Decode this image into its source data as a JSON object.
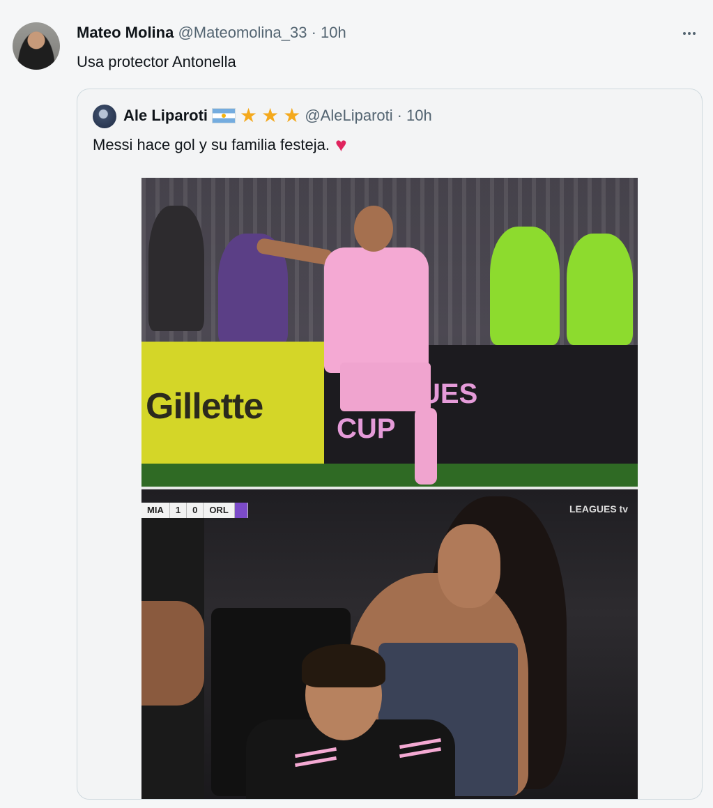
{
  "tweet": {
    "author_name": "Mateo Molina",
    "author_handle": "@Mateomolina_33",
    "separator": "·",
    "time": "10h",
    "text": "Usa protector Antonella"
  },
  "quote": {
    "author_name": "Ale Liparoti",
    "author_handle": "@AleLiparoti",
    "separator": "·",
    "time": "10h",
    "text": "Messi hace gol y su familia festeja.",
    "emoji_icons": [
      "argentina-flag-icon",
      "star-icon",
      "star-icon",
      "star-icon"
    ],
    "heart_icon": "red-heart-icon"
  },
  "media": {
    "ad_yellow": "Gillette",
    "ad_black_1": "AGUES",
    "ad_black_2": "CUP",
    "scorebug": {
      "home": "MIA",
      "home_score": "1",
      "away_score": "0",
      "away": "ORL"
    },
    "broadcast_logo": "LEAGUES  tv"
  },
  "colors": {
    "heart": "#e0245e",
    "star": "#f4a91d",
    "muted": "#536471"
  }
}
